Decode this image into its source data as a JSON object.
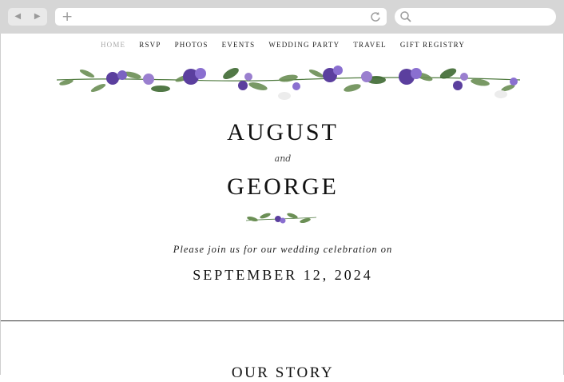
{
  "browser": {
    "back_icon": "back-arrow-icon",
    "forward_icon": "forward-arrow-icon",
    "new_tab_icon": "plus-icon",
    "reload_icon": "reload-icon",
    "search_icon": "search-icon",
    "back_glyph": "◀",
    "forward_glyph": "▶",
    "plus_glyph": "+"
  },
  "nav": {
    "items": [
      "HOME",
      "RSVP",
      "PHOTOS",
      "EVENTS",
      "WEDDING PARTY",
      "TRAVEL",
      "GIFT REGISTRY"
    ],
    "active": "HOME"
  },
  "hero": {
    "name_one": "AUGUST",
    "conjunction": "and",
    "name_two": "GEORGE",
    "invitation": "Please join us for our wedding celebration on",
    "date": "SEPTEMBER 12, 2024"
  },
  "sections": {
    "story_heading": "OUR STORY"
  },
  "colors": {
    "chrome": "#d6d6d6",
    "flower_purple": "#6a4fb0",
    "leaf_green": "#4f7a3f",
    "text": "#111111",
    "nav_active": "#a8a8a8"
  }
}
